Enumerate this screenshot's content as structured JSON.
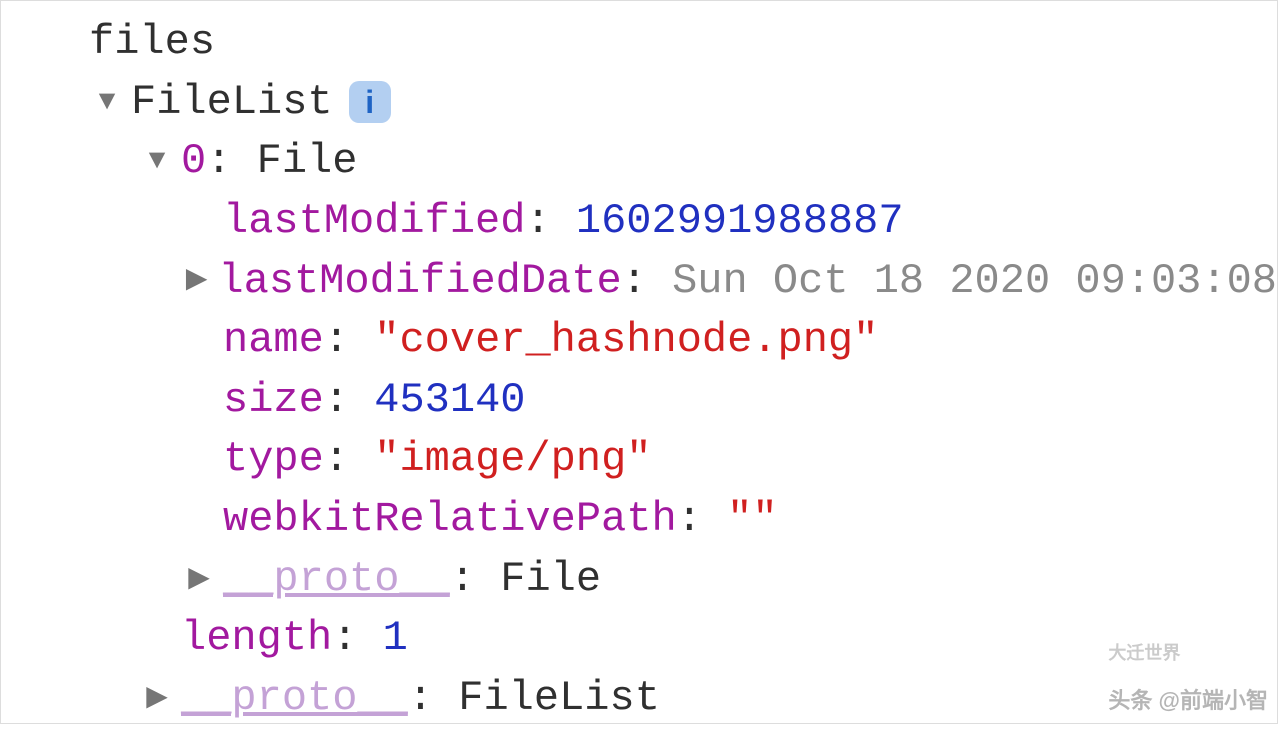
{
  "root": {
    "label": "files"
  },
  "filelist": {
    "type_label": "FileList",
    "info_glyph": "i"
  },
  "entry0": {
    "index": "0",
    "type_label": "File",
    "lastModified": {
      "key": "lastModified",
      "val": "1602991988887"
    },
    "lastModifiedDate": {
      "key": "lastModifiedDate",
      "val": "Sun Oct 18 2020 09:03:08"
    },
    "name": {
      "key": "name",
      "val": "\"cover_hashnode.png\""
    },
    "size": {
      "key": "size",
      "val": "453140"
    },
    "type": {
      "key": "type",
      "val": "\"image/png\""
    },
    "webkitRelativePath": {
      "key": "webkitRelativePath",
      "val": "\"\""
    },
    "proto": {
      "key": "__proto__",
      "val": "File"
    }
  },
  "length": {
    "key": "length",
    "val": "1"
  },
  "proto": {
    "key": "__proto__",
    "val": "FileList"
  },
  "glyphs": {
    "down": "▼",
    "right": "▶"
  },
  "watermark": {
    "top": "大迁世界",
    "bottom": "头条 @前端小智"
  }
}
